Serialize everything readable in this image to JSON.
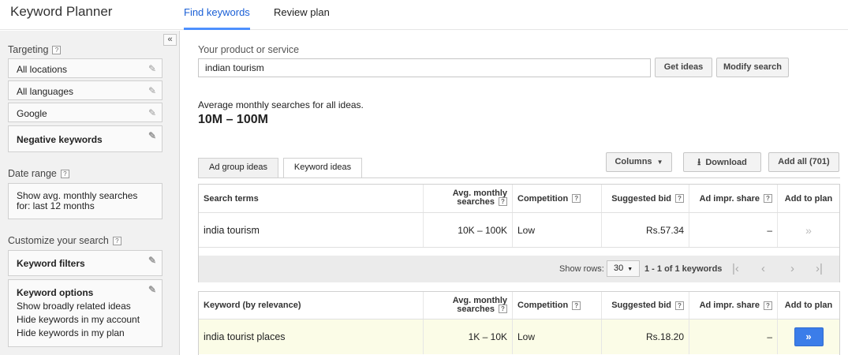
{
  "app": {
    "title": "Keyword Planner"
  },
  "top_tabs": [
    {
      "label": "Find keywords",
      "active": true
    },
    {
      "label": "Review plan",
      "active": false
    }
  ],
  "sidebar": {
    "collapse_glyph": "«",
    "targeting": {
      "title": "Targeting",
      "items": [
        "All locations",
        "All languages",
        "Google",
        "Negative keywords"
      ]
    },
    "date_range": {
      "title": "Date range",
      "line1": "Show avg. monthly searches",
      "line2": "for: last 12 months"
    },
    "customize": {
      "title": "Customize your search",
      "filters": "Keyword filters",
      "options_title": "Keyword options",
      "options": [
        "Show broadly related ideas",
        "Hide keywords in my account",
        "Hide keywords in my plan"
      ]
    }
  },
  "search": {
    "label": "Your product or service",
    "value": "indian tourism",
    "get_ideas": "Get ideas",
    "modify": "Modify search"
  },
  "summary": {
    "label": "Average monthly searches for all ideas.",
    "value": "10M – 100M"
  },
  "idea_tabs": [
    {
      "label": "Ad group ideas",
      "active": false
    },
    {
      "label": "Keyword ideas",
      "active": true
    }
  ],
  "toolbar": {
    "columns": "Columns",
    "download": "Download",
    "add_all": "Add all (701)"
  },
  "search_terms_table": {
    "headers": {
      "term": "Search terms",
      "avg_line1": "Avg. monthly",
      "avg_line2": "searches",
      "competition": "Competition",
      "bid": "Suggested bid",
      "impr": "Ad impr. share",
      "add": "Add to plan"
    },
    "row": {
      "term": "india tourism",
      "avg": "10K – 100K",
      "competition": "Low",
      "bid": "Rs.57.34",
      "impr": "–",
      "add": "»"
    }
  },
  "pager": {
    "show_rows": "Show rows:",
    "rows": "30",
    "range": "1 - 1 of 1 keywords"
  },
  "keyword_table": {
    "headers": {
      "term": "Keyword (by relevance)",
      "avg_line1": "Avg. monthly",
      "avg_line2": "searches",
      "competition": "Competition",
      "bid": "Suggested bid",
      "impr": "Ad impr. share",
      "add": "Add to plan"
    },
    "row": {
      "term": "india tourist places",
      "avg": "1K – 10K",
      "competition": "Low",
      "bid": "Rs.18.20",
      "impr": "–",
      "add": "»"
    }
  },
  "colors": {
    "accent": "#4d90fe",
    "highlight_row": "#fbfce7",
    "add_button": "#3b7de9"
  },
  "icons": [
    "pencil-icon",
    "help-icon",
    "download-icon",
    "dropdown-caret-icon",
    "first-page-icon",
    "prev-page-icon",
    "next-page-icon",
    "last-page-icon"
  ]
}
